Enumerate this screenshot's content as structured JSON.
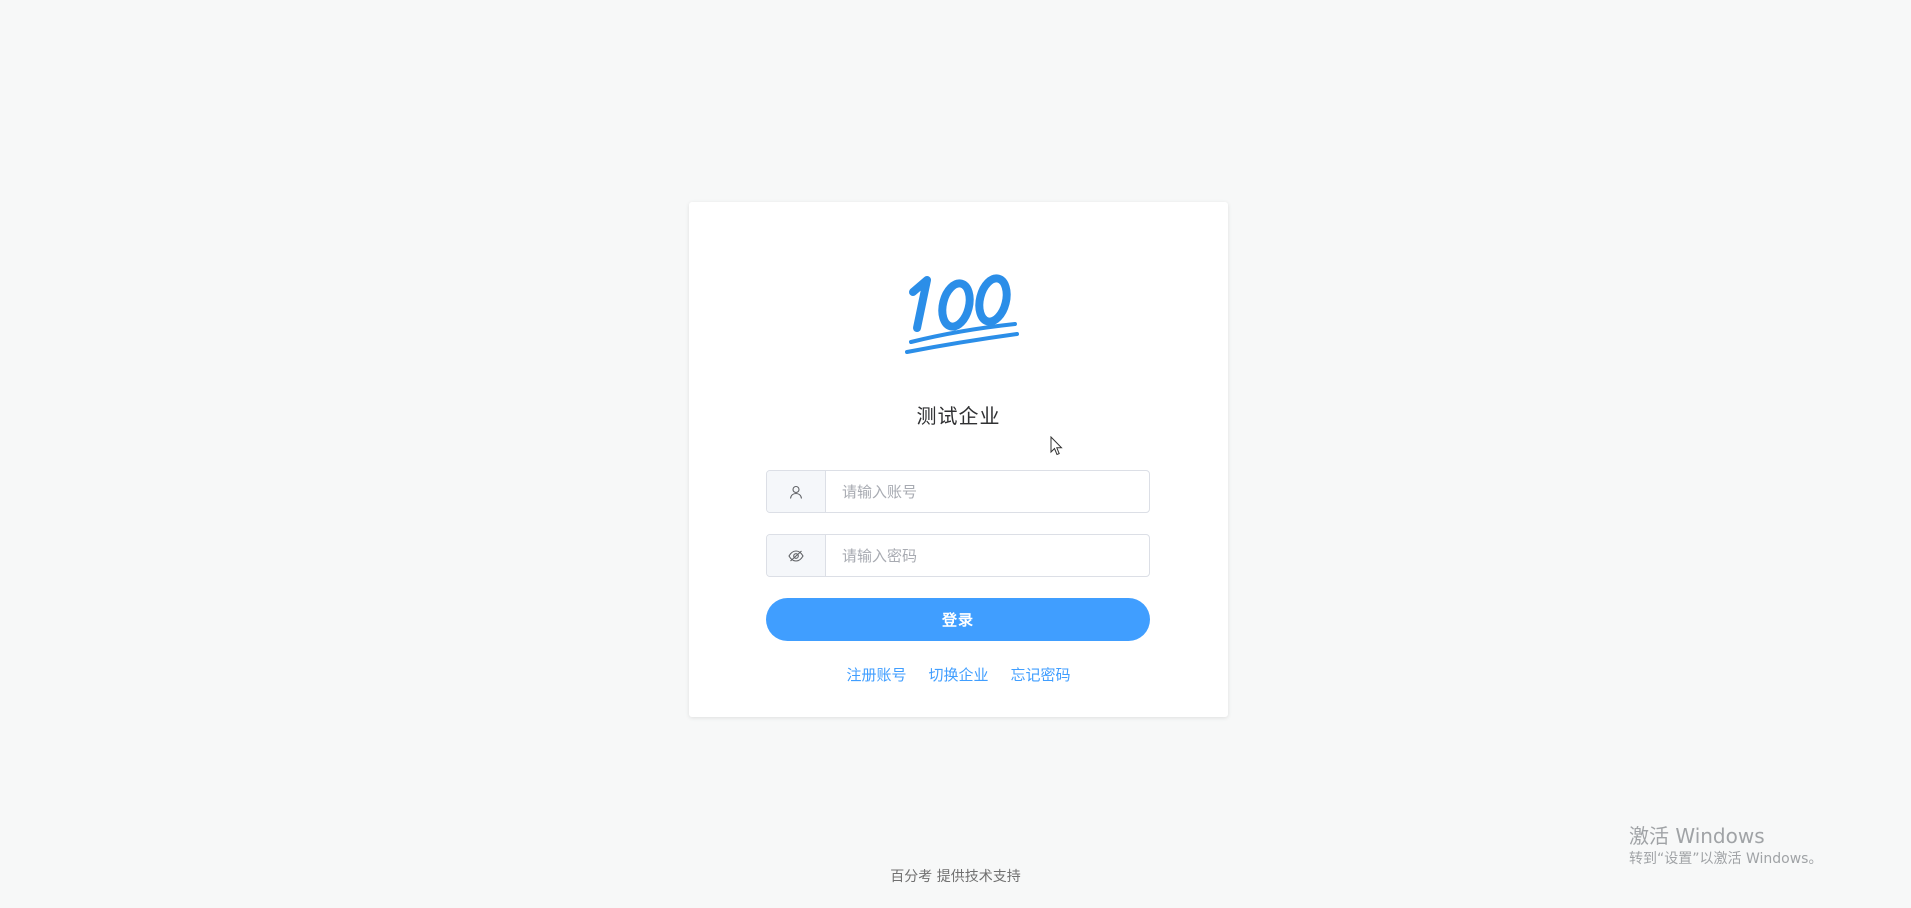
{
  "company_name": "测试企业",
  "logo": {
    "icon": "hundred-points-icon",
    "text": "100",
    "color": "#2b8ee8"
  },
  "username": {
    "icon": "user-icon",
    "placeholder": "请输入账号",
    "value": ""
  },
  "password": {
    "icon": "eye-hidden-icon",
    "placeholder": "请输入密码",
    "value": ""
  },
  "login_label": "登录",
  "links": {
    "register": "注册账号",
    "switch_company": "切换企业",
    "forgot_password": "忘记密码"
  },
  "footer": "百分考 提供技术支持",
  "watermark": {
    "title": "激活 Windows",
    "subtitle": "转到“设置”以激活 Windows。"
  },
  "colors": {
    "accent": "#409eff",
    "background": "#f7f8f8"
  }
}
